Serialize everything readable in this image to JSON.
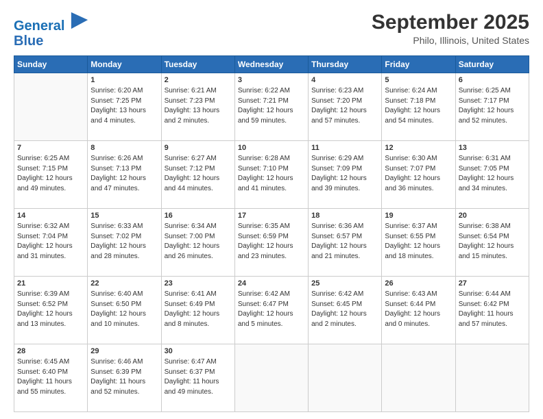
{
  "logo": {
    "line1": "General",
    "line2": "Blue"
  },
  "title": "September 2025",
  "location": "Philo, Illinois, United States",
  "days_of_week": [
    "Sunday",
    "Monday",
    "Tuesday",
    "Wednesday",
    "Thursday",
    "Friday",
    "Saturday"
  ],
  "weeks": [
    [
      {
        "day": "",
        "sunrise": "",
        "sunset": "",
        "daylight": "",
        "empty": true
      },
      {
        "day": "1",
        "sunrise": "Sunrise: 6:20 AM",
        "sunset": "Sunset: 7:25 PM",
        "daylight": "Daylight: 13 hours and 4 minutes."
      },
      {
        "day": "2",
        "sunrise": "Sunrise: 6:21 AM",
        "sunset": "Sunset: 7:23 PM",
        "daylight": "Daylight: 13 hours and 2 minutes."
      },
      {
        "day": "3",
        "sunrise": "Sunrise: 6:22 AM",
        "sunset": "Sunset: 7:21 PM",
        "daylight": "Daylight: 12 hours and 59 minutes."
      },
      {
        "day": "4",
        "sunrise": "Sunrise: 6:23 AM",
        "sunset": "Sunset: 7:20 PM",
        "daylight": "Daylight: 12 hours and 57 minutes."
      },
      {
        "day": "5",
        "sunrise": "Sunrise: 6:24 AM",
        "sunset": "Sunset: 7:18 PM",
        "daylight": "Daylight: 12 hours and 54 minutes."
      },
      {
        "day": "6",
        "sunrise": "Sunrise: 6:25 AM",
        "sunset": "Sunset: 7:17 PM",
        "daylight": "Daylight: 12 hours and 52 minutes."
      }
    ],
    [
      {
        "day": "7",
        "sunrise": "Sunrise: 6:25 AM",
        "sunset": "Sunset: 7:15 PM",
        "daylight": "Daylight: 12 hours and 49 minutes."
      },
      {
        "day": "8",
        "sunrise": "Sunrise: 6:26 AM",
        "sunset": "Sunset: 7:13 PM",
        "daylight": "Daylight: 12 hours and 47 minutes."
      },
      {
        "day": "9",
        "sunrise": "Sunrise: 6:27 AM",
        "sunset": "Sunset: 7:12 PM",
        "daylight": "Daylight: 12 hours and 44 minutes."
      },
      {
        "day": "10",
        "sunrise": "Sunrise: 6:28 AM",
        "sunset": "Sunset: 7:10 PM",
        "daylight": "Daylight: 12 hours and 41 minutes."
      },
      {
        "day": "11",
        "sunrise": "Sunrise: 6:29 AM",
        "sunset": "Sunset: 7:09 PM",
        "daylight": "Daylight: 12 hours and 39 minutes."
      },
      {
        "day": "12",
        "sunrise": "Sunrise: 6:30 AM",
        "sunset": "Sunset: 7:07 PM",
        "daylight": "Daylight: 12 hours and 36 minutes."
      },
      {
        "day": "13",
        "sunrise": "Sunrise: 6:31 AM",
        "sunset": "Sunset: 7:05 PM",
        "daylight": "Daylight: 12 hours and 34 minutes."
      }
    ],
    [
      {
        "day": "14",
        "sunrise": "Sunrise: 6:32 AM",
        "sunset": "Sunset: 7:04 PM",
        "daylight": "Daylight: 12 hours and 31 minutes."
      },
      {
        "day": "15",
        "sunrise": "Sunrise: 6:33 AM",
        "sunset": "Sunset: 7:02 PM",
        "daylight": "Daylight: 12 hours and 28 minutes."
      },
      {
        "day": "16",
        "sunrise": "Sunrise: 6:34 AM",
        "sunset": "Sunset: 7:00 PM",
        "daylight": "Daylight: 12 hours and 26 minutes."
      },
      {
        "day": "17",
        "sunrise": "Sunrise: 6:35 AM",
        "sunset": "Sunset: 6:59 PM",
        "daylight": "Daylight: 12 hours and 23 minutes."
      },
      {
        "day": "18",
        "sunrise": "Sunrise: 6:36 AM",
        "sunset": "Sunset: 6:57 PM",
        "daylight": "Daylight: 12 hours and 21 minutes."
      },
      {
        "day": "19",
        "sunrise": "Sunrise: 6:37 AM",
        "sunset": "Sunset: 6:55 PM",
        "daylight": "Daylight: 12 hours and 18 minutes."
      },
      {
        "day": "20",
        "sunrise": "Sunrise: 6:38 AM",
        "sunset": "Sunset: 6:54 PM",
        "daylight": "Daylight: 12 hours and 15 minutes."
      }
    ],
    [
      {
        "day": "21",
        "sunrise": "Sunrise: 6:39 AM",
        "sunset": "Sunset: 6:52 PM",
        "daylight": "Daylight: 12 hours and 13 minutes."
      },
      {
        "day": "22",
        "sunrise": "Sunrise: 6:40 AM",
        "sunset": "Sunset: 6:50 PM",
        "daylight": "Daylight: 12 hours and 10 minutes."
      },
      {
        "day": "23",
        "sunrise": "Sunrise: 6:41 AM",
        "sunset": "Sunset: 6:49 PM",
        "daylight": "Daylight: 12 hours and 8 minutes."
      },
      {
        "day": "24",
        "sunrise": "Sunrise: 6:42 AM",
        "sunset": "Sunset: 6:47 PM",
        "daylight": "Daylight: 12 hours and 5 minutes."
      },
      {
        "day": "25",
        "sunrise": "Sunrise: 6:42 AM",
        "sunset": "Sunset: 6:45 PM",
        "daylight": "Daylight: 12 hours and 2 minutes."
      },
      {
        "day": "26",
        "sunrise": "Sunrise: 6:43 AM",
        "sunset": "Sunset: 6:44 PM",
        "daylight": "Daylight: 12 hours and 0 minutes."
      },
      {
        "day": "27",
        "sunrise": "Sunrise: 6:44 AM",
        "sunset": "Sunset: 6:42 PM",
        "daylight": "Daylight: 11 hours and 57 minutes."
      }
    ],
    [
      {
        "day": "28",
        "sunrise": "Sunrise: 6:45 AM",
        "sunset": "Sunset: 6:40 PM",
        "daylight": "Daylight: 11 hours and 55 minutes."
      },
      {
        "day": "29",
        "sunrise": "Sunrise: 6:46 AM",
        "sunset": "Sunset: 6:39 PM",
        "daylight": "Daylight: 11 hours and 52 minutes."
      },
      {
        "day": "30",
        "sunrise": "Sunrise: 6:47 AM",
        "sunset": "Sunset: 6:37 PM",
        "daylight": "Daylight: 11 hours and 49 minutes."
      },
      {
        "day": "",
        "sunrise": "",
        "sunset": "",
        "daylight": "",
        "empty": true
      },
      {
        "day": "",
        "sunrise": "",
        "sunset": "",
        "daylight": "",
        "empty": true
      },
      {
        "day": "",
        "sunrise": "",
        "sunset": "",
        "daylight": "",
        "empty": true
      },
      {
        "day": "",
        "sunrise": "",
        "sunset": "",
        "daylight": "",
        "empty": true
      }
    ]
  ]
}
